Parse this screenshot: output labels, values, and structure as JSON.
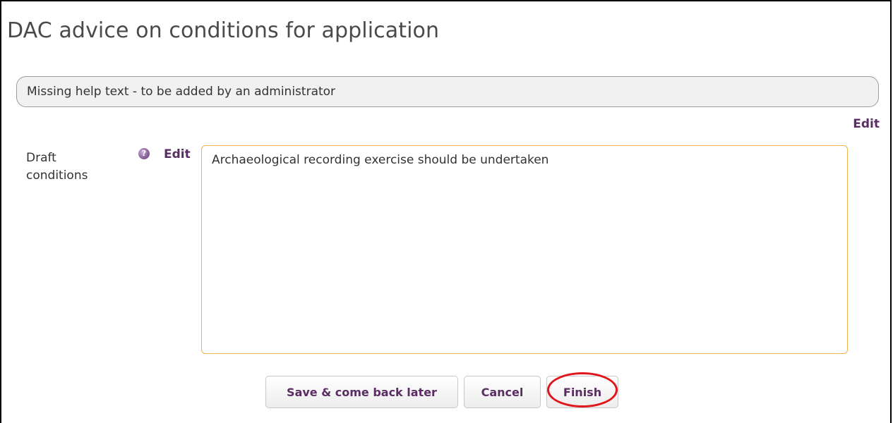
{
  "page": {
    "title": "DAC advice on conditions for application"
  },
  "help": {
    "text": "Missing help text - to be added by an administrator",
    "edit_label": "Edit"
  },
  "field": {
    "label": "Draft conditions",
    "help_icon_glyph": "?",
    "edit_label": "Edit",
    "value": "Archaeological recording exercise should be undertaken"
  },
  "buttons": {
    "save_label": "Save & come back later",
    "cancel_label": "Cancel",
    "finish_label": "Finish"
  },
  "colors": {
    "link": "#5a2d63",
    "textarea_focus_border": "#f0b24a",
    "highlight_ring": "#e1161b"
  },
  "icons": {
    "help": "help-icon"
  }
}
